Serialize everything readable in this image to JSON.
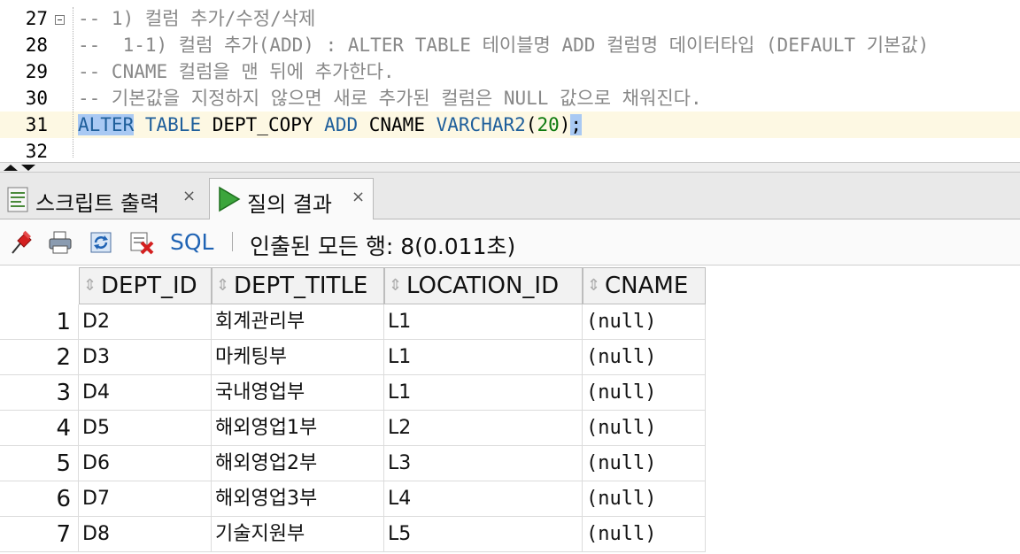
{
  "editor": {
    "lines": [
      {
        "num": "27",
        "parts": [
          {
            "t": "-- 1) 컬럼 추가/수정/삭제",
            "c": "cmt"
          }
        ],
        "fold": true
      },
      {
        "num": "28",
        "parts": [
          {
            "t": "--  1-1) 컬럼 추가(ADD) : ALTER TABLE 테이블명 ADD 컬럼명 데이터타입 (DEFAULT 기본값)",
            "c": "cmt"
          }
        ]
      },
      {
        "num": "29",
        "parts": [
          {
            "t": "-- CNAME 컬럼을 맨 뒤에 추가한다.",
            "c": "cmt"
          }
        ]
      },
      {
        "num": "30",
        "parts": [
          {
            "t": "-- 기본값을 지정하지 않으면 새로 추가된 컬럼은 NULL 값으로 채워진다.",
            "c": "cmt"
          }
        ]
      },
      {
        "num": "31",
        "current": true,
        "parts": [
          {
            "t": "ALTER",
            "c": "kw sel"
          },
          {
            "t": " ",
            "c": "plain"
          },
          {
            "t": "TABLE",
            "c": "kw"
          },
          {
            "t": " DEPT_COPY ",
            "c": "plain"
          },
          {
            "t": "ADD",
            "c": "kw"
          },
          {
            "t": " CNAME ",
            "c": "plain"
          },
          {
            "t": "VARCHAR2",
            "c": "kw"
          },
          {
            "t": "(",
            "c": "plain"
          },
          {
            "t": "20",
            "c": "num"
          },
          {
            "t": ")",
            "c": "plain"
          },
          {
            "t": ";",
            "c": "plain sel"
          }
        ]
      },
      {
        "num": "32",
        "parts": []
      }
    ]
  },
  "tabs": [
    {
      "label": "스크립트 출력",
      "close": "×",
      "icon": "script-output-icon",
      "active": false
    },
    {
      "label": "질의 결과",
      "close": "×",
      "icon": "run-query-icon",
      "active": true
    }
  ],
  "toolbar": {
    "icons": [
      "pin-icon",
      "print-icon",
      "refresh-icon",
      "clear-icon"
    ],
    "sql_label": "SQL",
    "status": "인출된 모든 행: 8(0.011초)"
  },
  "grid": {
    "columns": [
      "DEPT_ID",
      "DEPT_TITLE",
      "LOCATION_ID",
      "CNAME"
    ],
    "rows": [
      {
        "n": "1",
        "cells": [
          "D2",
          "회계관리부",
          "L1",
          "(null)"
        ]
      },
      {
        "n": "2",
        "cells": [
          "D3",
          "마케팅부",
          "L1",
          "(null)"
        ]
      },
      {
        "n": "3",
        "cells": [
          "D4",
          "국내영업부",
          "L1",
          "(null)"
        ]
      },
      {
        "n": "4",
        "cells": [
          "D5",
          "해외영업1부",
          "L2",
          "(null)"
        ]
      },
      {
        "n": "5",
        "cells": [
          "D6",
          "해외영업2부",
          "L3",
          "(null)"
        ]
      },
      {
        "n": "6",
        "cells": [
          "D7",
          "해외영업3부",
          "L4",
          "(null)"
        ]
      },
      {
        "n": "7",
        "cells": [
          "D8",
          "기술지원부",
          "L5",
          "(null)"
        ]
      }
    ]
  },
  "colors": {
    "keyword": "#1f5f9b",
    "comment": "#888888",
    "number": "#0e7a0e",
    "selection": "#a9c9f3",
    "sql_link": "#1f63b4"
  }
}
